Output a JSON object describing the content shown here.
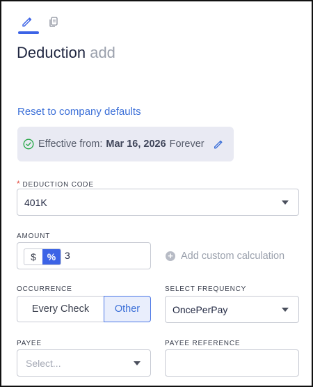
{
  "tabs": [
    {
      "name": "edit",
      "icon": "pencil-icon",
      "active": true
    },
    {
      "name": "copy",
      "icon": "copy-document-icon",
      "active": false
    }
  ],
  "title": {
    "main": "Deduction",
    "sub": "add"
  },
  "reset_link": "Reset to company defaults",
  "effective": {
    "label": "Effective from:",
    "date": "Mar 16, 2026",
    "until": "Forever",
    "status_icon": "check-circle-icon",
    "edit_icon": "pencil-icon"
  },
  "deduction_code": {
    "required_mark": "*",
    "label": "DEDUCTION CODE",
    "value": "401K"
  },
  "amount": {
    "label": "AMOUNT",
    "options": [
      "$",
      "%"
    ],
    "selected": "%",
    "value": "3",
    "add_calc_icon": "plus-circle-icon",
    "add_calc_label": "Add custom calculation"
  },
  "occurrence": {
    "label": "OCCURRENCE",
    "options": [
      "Every Check",
      "Other"
    ],
    "selected": "Other"
  },
  "frequency": {
    "label": "SELECT FREQUENCY",
    "value": "OncePerPay"
  },
  "payee": {
    "label": "PAYEE",
    "placeholder": "Select..."
  },
  "payee_reference": {
    "label": "PAYEE REFERENCE",
    "value": ""
  },
  "colors": {
    "accent": "#3c63e6",
    "link": "#3b6fd8",
    "required": "#e0453a",
    "success": "#2aa84a",
    "panel": "#e9eaf3"
  }
}
